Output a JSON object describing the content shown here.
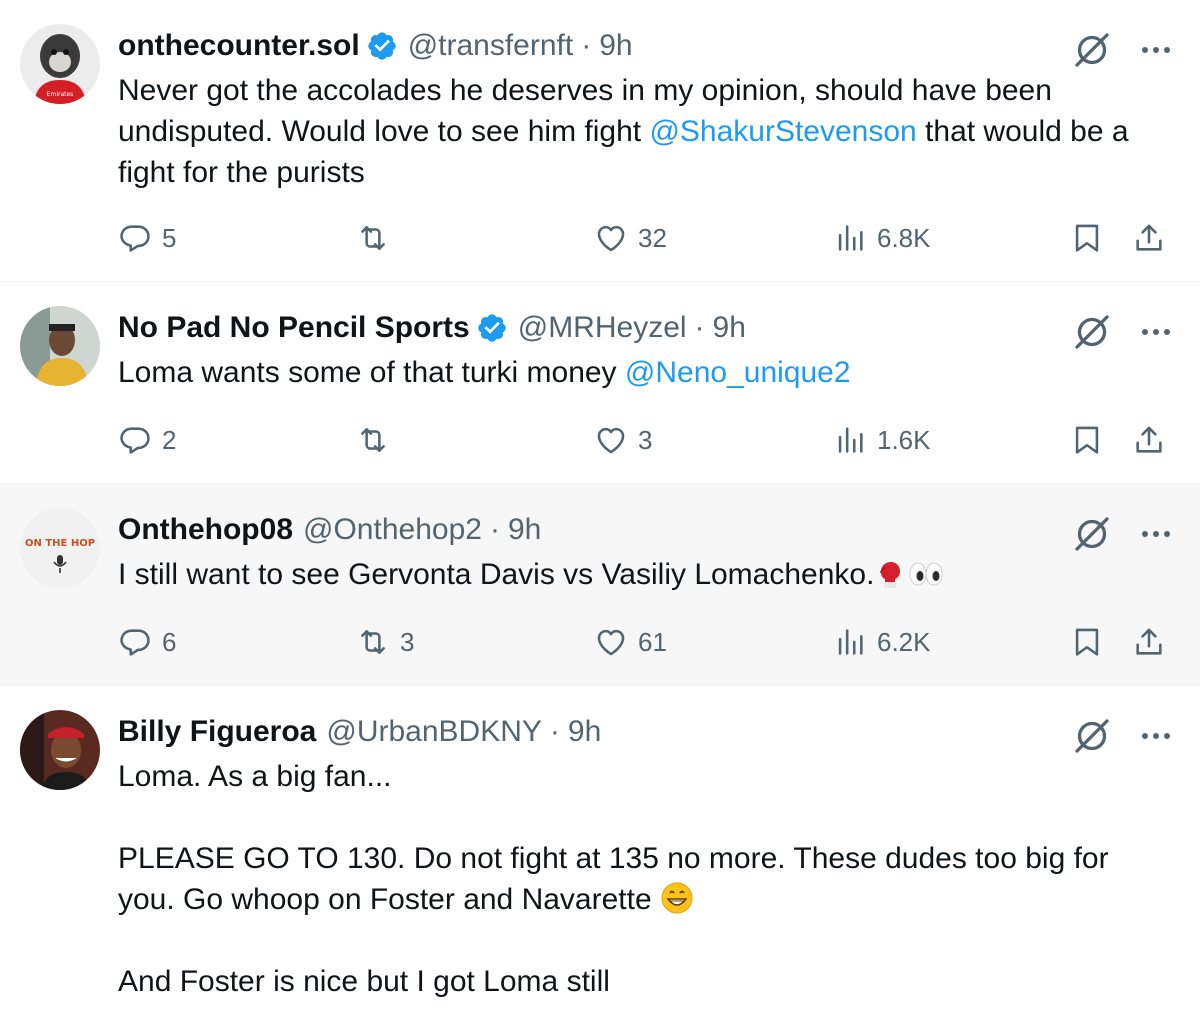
{
  "tweets": [
    {
      "name": "onthecounter.sol",
      "verified": true,
      "handle": "@transfernft",
      "dot": "·",
      "time": "9h",
      "text_parts": [
        "Never got the accolades he deserves in my opinion, should have been undisputed. Would love to see him fight ",
        "@ShakurStevenson",
        " that would be a fight for the purists"
      ],
      "replies": "5",
      "reposts": "",
      "likes": "32",
      "views": "6.8K",
      "avatar_text": "Emirates"
    },
    {
      "name": "No Pad No Pencil Sports",
      "verified": true,
      "handle": "@MRHeyzel",
      "dot": "·",
      "time": "9h",
      "text_parts": [
        "Loma wants some of that turki money ",
        "@Neno_unique2"
      ],
      "replies": "2",
      "reposts": "",
      "likes": "3",
      "views": "1.6K"
    },
    {
      "name": "Onthehop08",
      "verified": false,
      "handle": "@Onthehop2",
      "dot": "·",
      "time": "9h",
      "text_parts": [
        "I still want to see Gervonta Davis vs Vasiliy Lomachenko."
      ],
      "emojis": [
        "boxing-glove",
        "eyes"
      ],
      "replies": "6",
      "reposts": "3",
      "likes": "61",
      "views": "6.2K",
      "avatar_text": "ON THE HOP",
      "highlighted": true
    },
    {
      "name": "Billy Figueroa",
      "verified": false,
      "handle": "@UrbanBDKNY",
      "dot": "·",
      "time": "9h",
      "paragraphs": [
        "Loma. As a big fan...",
        "PLEASE GO TO 130. Do not fight at 135 no more. These dudes too big for you. Go whoop on Foster and Navarette",
        "And Foster is nice but I got Loma still"
      ],
      "emoji_after_p2": "grinning-face"
    }
  ],
  "colors": {
    "text": "#0f1419",
    "secondary": "#536471",
    "link": "#1d9bf0",
    "verified": "#1d9bf0",
    "highlight_bg": "#f7f7f7",
    "divider": "#eff3f4"
  }
}
